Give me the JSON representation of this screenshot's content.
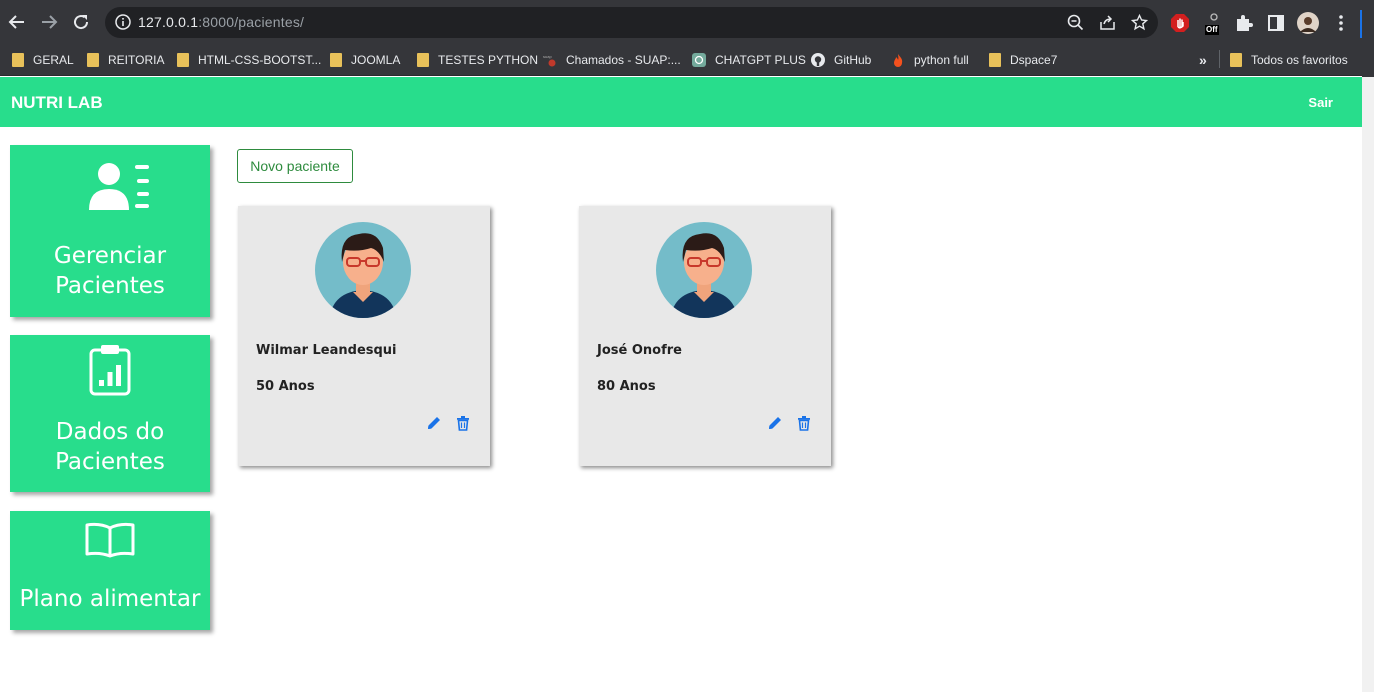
{
  "browser": {
    "url_host": "127.0.0.1",
    "url_rest": ":8000/pacientes/",
    "ext_off_label": "Off",
    "bookmarks": [
      {
        "label": "GERAL",
        "icon": "folder-icon"
      },
      {
        "label": "REITORIA",
        "icon": "folder-icon"
      },
      {
        "label": "HTML-CSS-BOOTST...",
        "icon": "folder-icon"
      },
      {
        "label": "JOOMLA",
        "icon": "folder-icon"
      },
      {
        "label": "TESTES PYTHON",
        "icon": "folder-icon"
      },
      {
        "label": "Chamados - SUAP:...",
        "icon": "suap-icon"
      },
      {
        "label": "CHATGPT PLUS",
        "icon": "chatgpt-icon"
      },
      {
        "label": "GitHub",
        "icon": "github-icon"
      },
      {
        "label": "python full",
        "icon": "fire-icon"
      },
      {
        "label": "Dspace7",
        "icon": "folder-icon"
      }
    ],
    "overflow_label": "»",
    "all_bookmarks_label": "Todos os favoritos"
  },
  "navbar": {
    "brand": "NUTRI LAB",
    "logout": "Sair"
  },
  "sidebar": {
    "items": [
      {
        "line1": "Gerenciar",
        "line2": "Pacientes",
        "icon": "user-list-icon"
      },
      {
        "line1": "Dados do",
        "line2": "Pacientes",
        "icon": "clipboard-chart-icon"
      },
      {
        "line1": "Plano alimentar",
        "icon": "book-icon"
      }
    ]
  },
  "main": {
    "new_patient_label": "Novo paciente",
    "patients": [
      {
        "name": "Wilmar Leandesqui",
        "age": "50 Anos"
      },
      {
        "name": "José Onofre",
        "age": "80 Anos"
      }
    ]
  },
  "colors": {
    "brand": "#28dd8c",
    "button_outline": "#2e8b3e",
    "action_icon": "#1a73e8"
  }
}
